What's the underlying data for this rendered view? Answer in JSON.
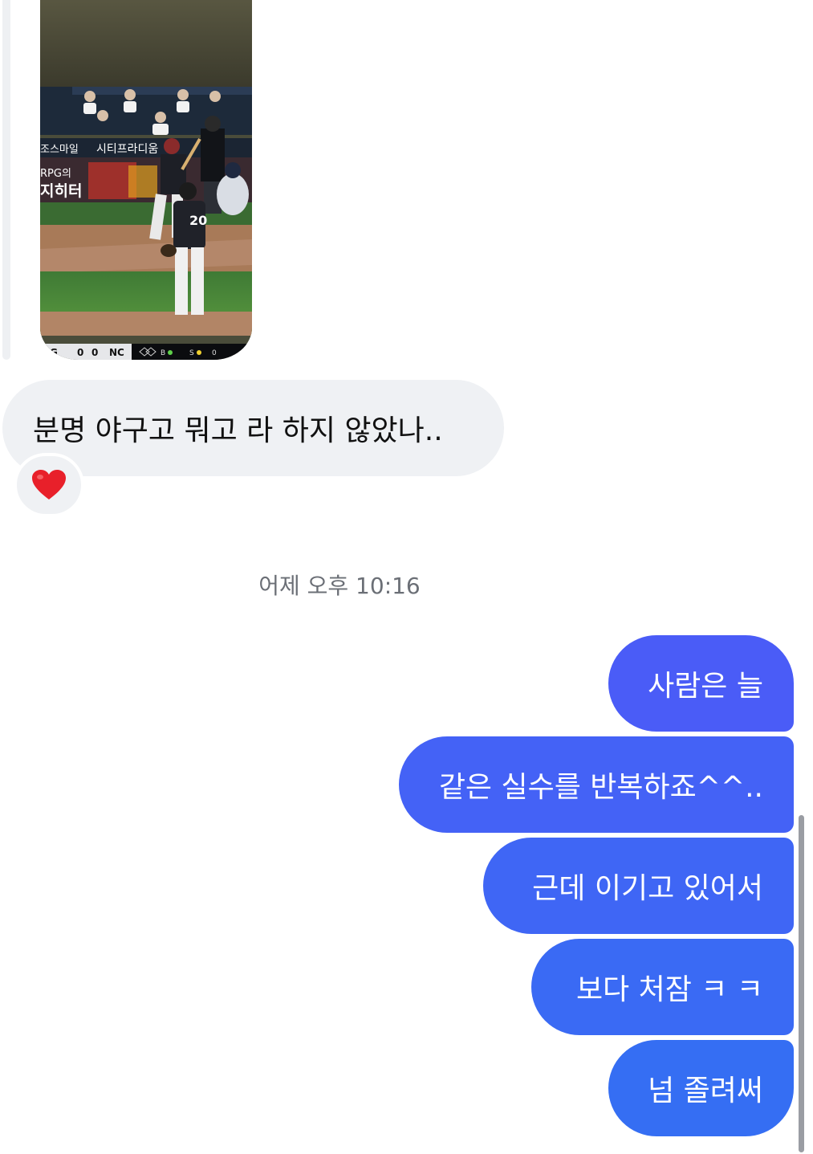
{
  "thread": {
    "received_photo": {
      "board_texts": [
        "시티프라디움",
        "조스마일",
        "RPG의",
        "지히터"
      ],
      "scoreboard": {
        "away_team": "G",
        "away_score": "0",
        "home_score": "0",
        "home_team": "NC",
        "balls": "B",
        "strikes": "S",
        "outs": "0"
      }
    },
    "received_message": {
      "text": "분명 야구고 뭐고 라 하지 않았나..",
      "reaction_icon": "red-heart-icon"
    },
    "timestamp": "어제 오후 10:16",
    "sent_messages": [
      {
        "text": "사람은 늘",
        "color": "#4a5cf7"
      },
      {
        "text": "같은 실수를 반복하죠^^..",
        "color": "#4462f6"
      },
      {
        "text": "근데 이기고 있어서",
        "color": "#3f66f5"
      },
      {
        "text": "보다 처잠 ㅋ ㅋ",
        "color": "#3a6af4"
      },
      {
        "text": "넘 졸려써",
        "color": "#356ef3"
      }
    ]
  },
  "colors": {
    "received_bubble": "#eff1f4",
    "timestamp_text": "#6b6f76",
    "heart": "#e8202a"
  }
}
